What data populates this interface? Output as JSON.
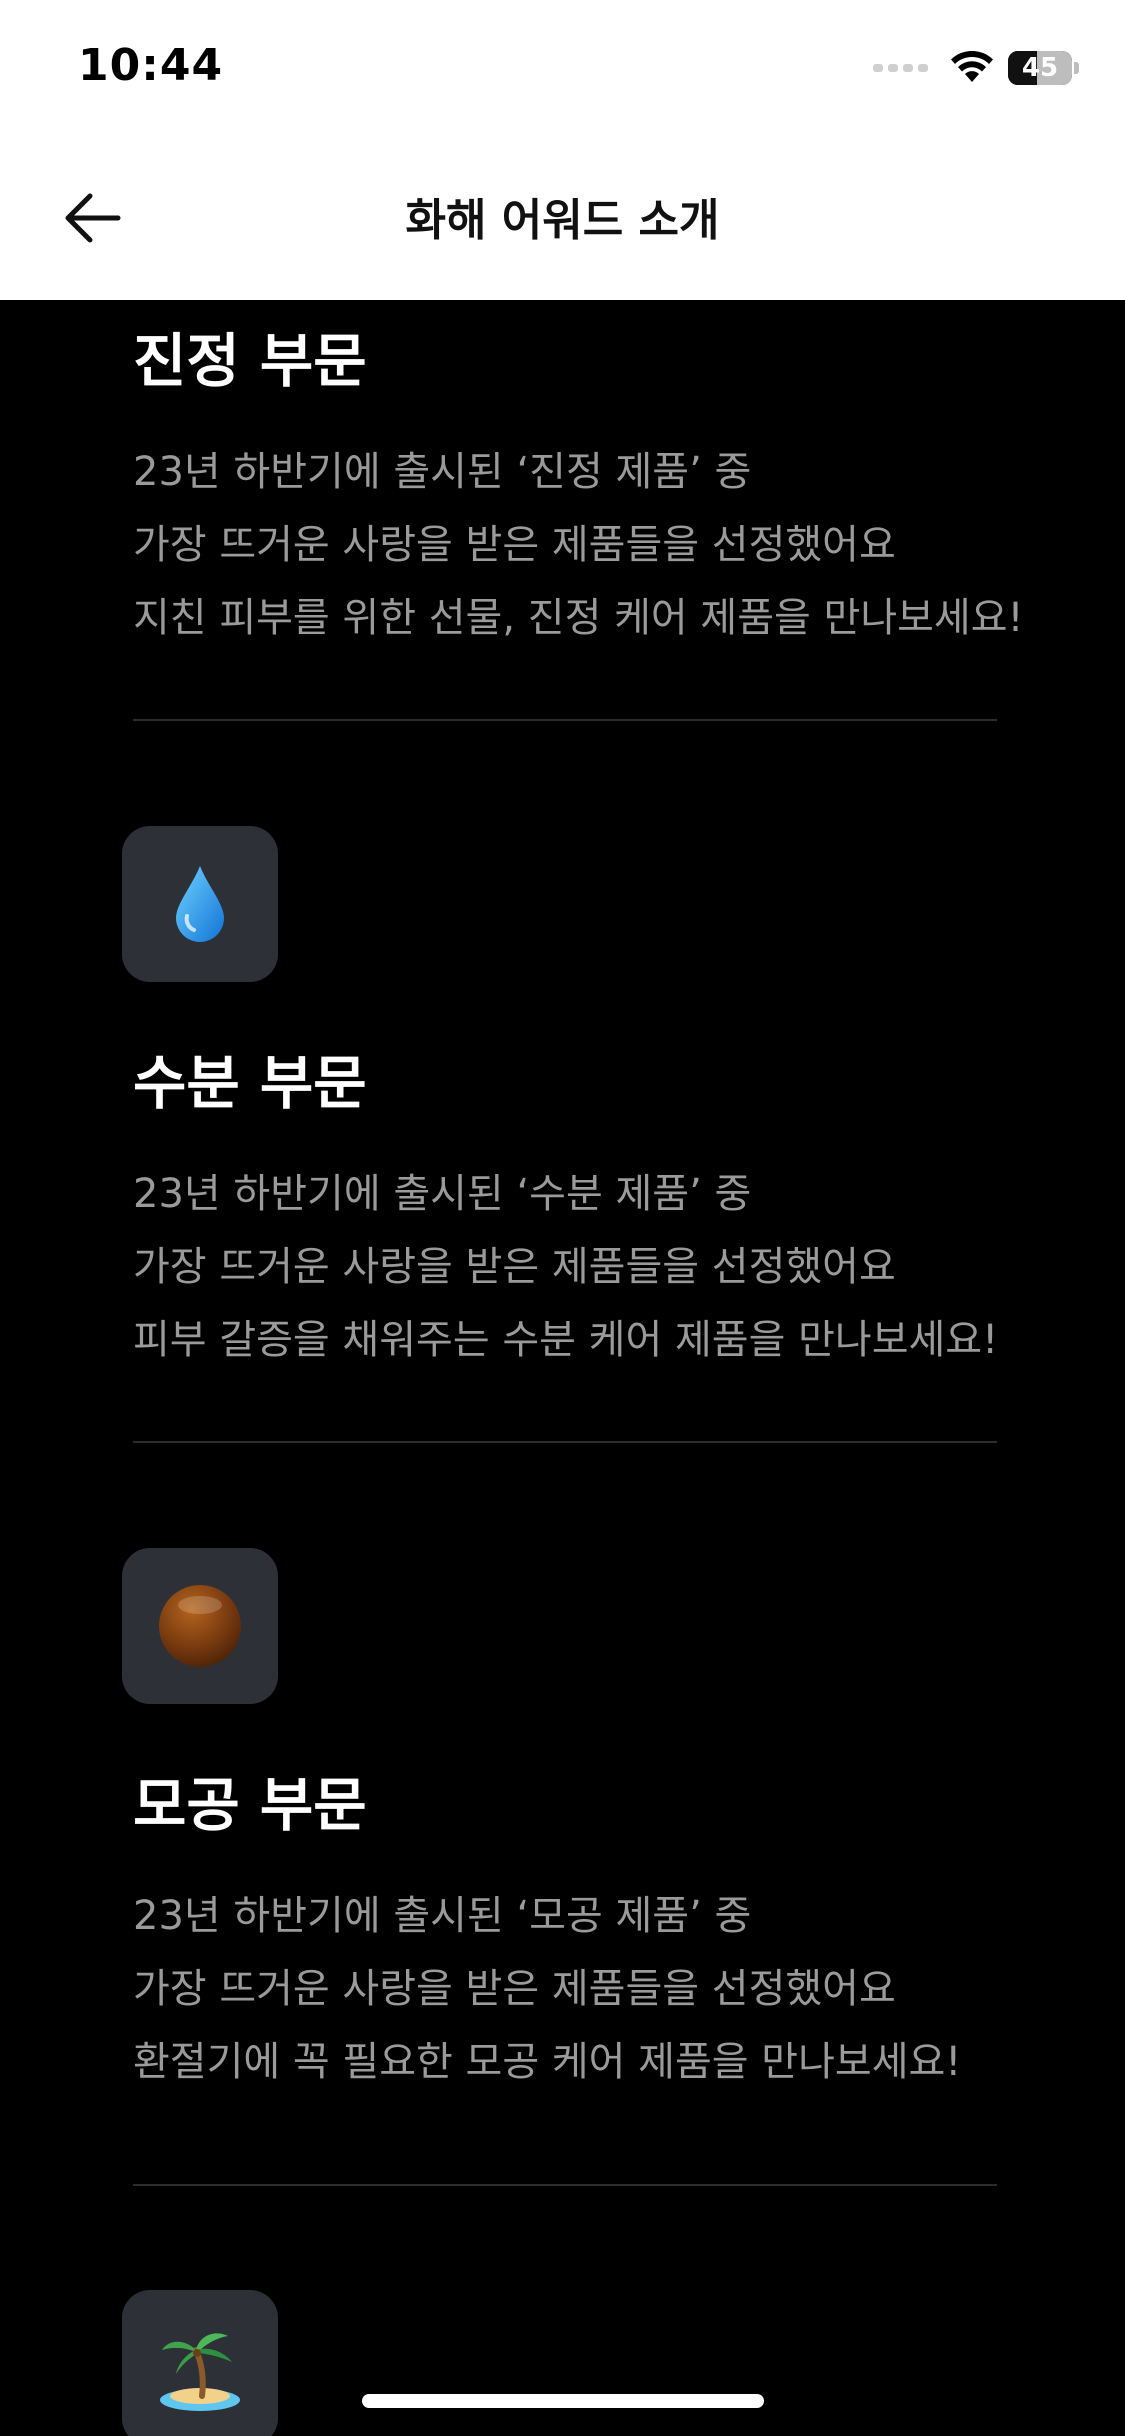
{
  "status_bar": {
    "time": "10:44",
    "battery_percent": 45,
    "battery_label": "45"
  },
  "nav": {
    "title": "화해 어워드 소개",
    "back_icon": "arrow-left-icon"
  },
  "sections": [
    {
      "title": "진정 부문",
      "lines": [
        "23년 하반기에 출시된 ‘진정 제품’ 중",
        "가장 뜨거운 사랑을 받은 제품들을 선정했어요",
        "지친 피부를 위한 선물, 진정 케어 제품을 만나보세요!"
      ]
    },
    {
      "icon": "water-drop-icon",
      "title": "수분 부문",
      "lines": [
        "23년 하반기에 출시된 ‘수분 제품’ 중",
        "가장 뜨거운 사랑을 받은 제품들을 선정했어요",
        "피부 갈증을 채워주는 수분 케어 제품을 만나보세요!"
      ]
    },
    {
      "icon": "brown-circle-icon",
      "title": "모공 부문",
      "lines": [
        "23년 하반기에 출시된 ‘모공 제품’ 중",
        "가장 뜨거운 사랑을 받은 제품들을 선정했어요",
        "환절기에 꼭 필요한 모공 케어 제품을 만나보세요!"
      ]
    },
    {
      "icon": "palm-island-icon"
    }
  ],
  "colors": {
    "background": "#000000",
    "title": "#ffffff",
    "description": "#9a9a9a",
    "icon_tile": "#2e3038",
    "divider": "#2c2c2c"
  }
}
